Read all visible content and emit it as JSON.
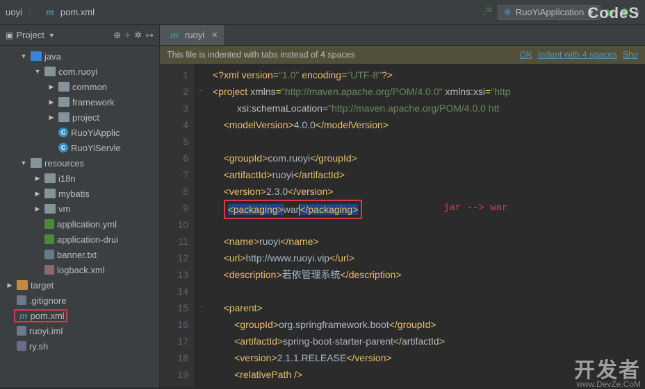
{
  "crumb": {
    "project": "uoyi",
    "file": "pom.xml"
  },
  "runconfig": {
    "name": "RuoYiApplication"
  },
  "logo": "CodeS",
  "sidebar": {
    "title": "Project",
    "tree": [
      {
        "label": "java",
        "indent": 1,
        "arrow": "down",
        "icon": "folder-blue"
      },
      {
        "label": "com.ruoyi",
        "indent": 2,
        "arrow": "down",
        "icon": "folder-gray"
      },
      {
        "label": "common",
        "indent": 3,
        "arrow": "right",
        "icon": "folder-gray"
      },
      {
        "label": "framework",
        "indent": 3,
        "arrow": "right",
        "icon": "folder-gray"
      },
      {
        "label": "project",
        "indent": 3,
        "arrow": "right",
        "icon": "folder-gray"
      },
      {
        "label": "RuoYiApplic",
        "indent": 3,
        "arrow": "",
        "icon": "class",
        "iconText": "C"
      },
      {
        "label": "RuoYiServle",
        "indent": 3,
        "arrow": "",
        "icon": "class",
        "iconText": "C"
      },
      {
        "label": "resources",
        "indent": 1,
        "arrow": "down",
        "icon": "folder-gray"
      },
      {
        "label": "i18n",
        "indent": 2,
        "arrow": "right",
        "icon": "folder-gray"
      },
      {
        "label": "mybatis",
        "indent": 2,
        "arrow": "right",
        "icon": "folder-gray"
      },
      {
        "label": "vm",
        "indent": 2,
        "arrow": "right",
        "icon": "folder-gray"
      },
      {
        "label": "application.yml",
        "indent": 2,
        "arrow": "",
        "icon": "yml"
      },
      {
        "label": "application-drui",
        "indent": 2,
        "arrow": "",
        "icon": "yml"
      },
      {
        "label": "banner.txt",
        "indent": 2,
        "arrow": "",
        "icon": "txt"
      },
      {
        "label": "logback.xml",
        "indent": 2,
        "arrow": "",
        "icon": "xml"
      },
      {
        "label": "target",
        "indent": 0,
        "arrow": "right",
        "icon": "folder-orange"
      },
      {
        "label": ".gitignore",
        "indent": 0,
        "arrow": "",
        "icon": "txt"
      },
      {
        "label": "pom.xml",
        "indent": 0,
        "arrow": "",
        "icon": "m",
        "highlight": true
      },
      {
        "label": "ruoyi.iml",
        "indent": 0,
        "arrow": "",
        "icon": "txt"
      },
      {
        "label": "ry.sh",
        "indent": 0,
        "arrow": "",
        "icon": "sh"
      }
    ]
  },
  "tab": {
    "name": "ruoyi"
  },
  "banner": {
    "msg": "This file is indented with tabs instead of 4 spaces",
    "ok": "OK",
    "indent": "Indent with 4 spaces",
    "show": "Sho"
  },
  "annotation": "jar --> war",
  "lines": [
    {
      "n": 1,
      "html": "<span class='c-pi'>&lt;?</span><span class='c-tag'>xml version</span><span class='c-attr'>=</span><span class='c-str'>\"1.0\"</span> <span class='c-tag'>encoding</span><span class='c-attr'>=</span><span class='c-str'>\"UTF-8\"</span><span class='c-pi'>?&gt;</span>"
    },
    {
      "n": 2,
      "fold": "−",
      "html": "<span class='c-tag'>&lt;project </span><span class='c-attr'>xmlns</span><span class='c-tag'>=</span><span class='c-str'>\"http://maven.apache.org/POM/4.0.0\"</span> <span class='c-attr'>xmlns:xsi</span><span class='c-tag'>=</span><span class='c-str'>\"http</span>"
    },
    {
      "n": 3,
      "html": "         <span class='c-attr'>xsi:schemaLocation</span><span class='c-tag'>=</span><span class='c-str'>\"http://maven.apache.org/POM/4.0.0 htt</span>"
    },
    {
      "n": 4,
      "html": "    <span class='c-tag'>&lt;modelVersion&gt;</span><span class='c-text'>4.0.0</span><span class='c-tag'>&lt;/modelVersion&gt;</span>"
    },
    {
      "n": 5,
      "html": ""
    },
    {
      "n": 6,
      "html": "    <span class='c-tag'>&lt;groupId&gt;</span><span class='c-text'>com.ruoyi</span><span class='c-tag'>&lt;/groupId&gt;</span>"
    },
    {
      "n": 7,
      "html": "    <span class='c-tag'>&lt;artifactId&gt;</span><span class='c-text'>ruoyi</span><span class='c-tag'>&lt;/artifactId&gt;</span>"
    },
    {
      "n": 8,
      "html": "    <span class='c-tag'>&lt;version&gt;</span><span class='c-text'>2.3.0</span><span class='c-tag'>&lt;/version&gt;</span>"
    },
    {
      "n": 9,
      "html": "    <span class='packaging-box'><span class='c-tag hl'>&lt;packaging&gt;</span><span class='c-text'>war</span><span class='cursor'></span><span class='c-tag hl'>&lt;/packaging&gt;</span></span>"
    },
    {
      "n": 10,
      "html": ""
    },
    {
      "n": 11,
      "html": "    <span class='c-tag'>&lt;name&gt;</span><span class='c-text'>ruoyi</span><span class='c-tag'>&lt;/name&gt;</span>"
    },
    {
      "n": 12,
      "html": "    <span class='c-tag'>&lt;url&gt;</span><span class='c-text'>http://www.ruoyi.vip</span><span class='c-tag'>&lt;/url&gt;</span>"
    },
    {
      "n": 13,
      "html": "    <span class='c-tag'>&lt;description&gt;</span><span class='c-text'>若依管理系统</span><span class='c-tag'>&lt;/description&gt;</span>"
    },
    {
      "n": 14,
      "html": ""
    },
    {
      "n": 15,
      "fold": "−",
      "html": "    <span class='c-tag'>&lt;parent&gt;</span>"
    },
    {
      "n": 16,
      "html": "        <span class='c-tag'>&lt;groupId&gt;</span><span class='c-text'>org.springframework.boot</span><span class='c-tag'>&lt;/groupId&gt;</span>"
    },
    {
      "n": 17,
      "html": "        <span class='c-tag'>&lt;artifactId&gt;</span><span class='c-text'>spring-boot-starter-parent</span><span class='c-tag'>&lt;/</span><span class='c-attr'>artifactId</span><span class='c-tag'>&gt;</span>"
    },
    {
      "n": 18,
      "html": "        <span class='c-tag'>&lt;version&gt;</span><span class='c-text'>2.1.1.RELEASE</span><span class='c-tag'>&lt;/version&gt;</span>"
    },
    {
      "n": 19,
      "html": "        <span class='c-tag'>&lt;relativePath /&gt;</span>"
    }
  ],
  "watermark": {
    "big": "开发者",
    "small": "www.DevZe.CoM"
  }
}
